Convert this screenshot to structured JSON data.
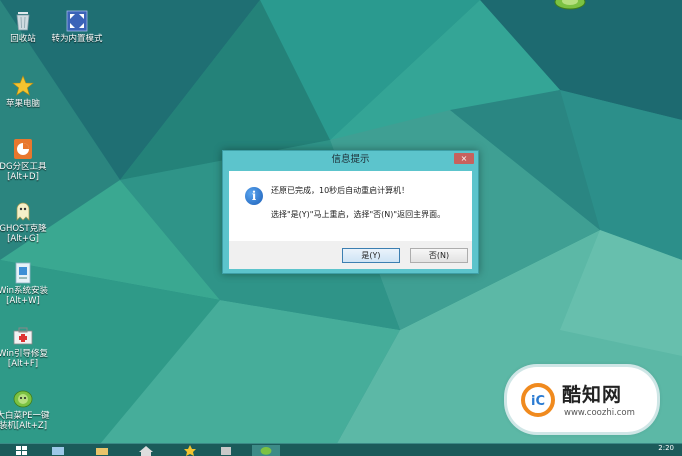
{
  "desktop": {
    "icons": [
      {
        "label": "回收站"
      },
      {
        "label": "转为内置模式"
      },
      {
        "label": "苹果电脑"
      },
      {
        "label": "DG分区工具\n[Alt+D]"
      },
      {
        "label": "GHOST克隆\n[Alt+G]"
      },
      {
        "label": "Win系统安装\n[Alt+W]"
      },
      {
        "label": "Win引导修复\n[Alt+F]"
      },
      {
        "label": "大白菜PE一键\n装机[Alt+Z]"
      }
    ]
  },
  "dialog": {
    "title": "信息提示",
    "close_label": "×",
    "message_line1": "还原已完成，10秒后自动重启计算机！",
    "message_line2": "选择\"是(Y)\"马上重启，选择\"否(N)\"返回主界面。",
    "yes_label": "是(Y)",
    "no_label": "否(N)",
    "info_glyph": "i"
  },
  "taskbar": {
    "clock": "2:20"
  },
  "watermark": {
    "title": "酷知网",
    "url": "www.coozhi.com"
  },
  "colors": {
    "dialog_frame": "#5cc4cc",
    "close_button": "#c8615d",
    "desktop_base": "#2e8f86",
    "watermark_logo": "#f08a1e"
  }
}
